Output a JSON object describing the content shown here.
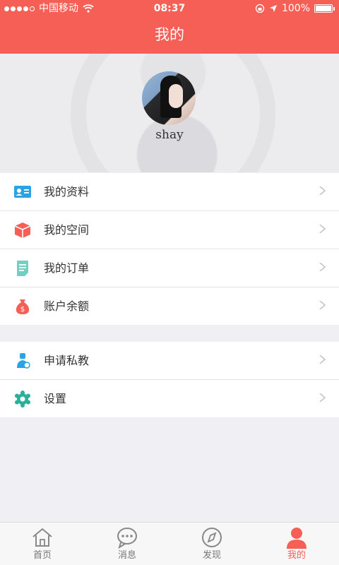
{
  "status_bar": {
    "carrier": "中国移动",
    "time": "08:37",
    "battery": "100%"
  },
  "nav": {
    "title": "我的"
  },
  "profile": {
    "username": "shay"
  },
  "menu_group_1": [
    {
      "label": "我的资料",
      "icon": "id-card-icon",
      "color": "#2aa3e6"
    },
    {
      "label": "我的空间",
      "icon": "cube-icon",
      "color": "#f65f55"
    },
    {
      "label": "我的订单",
      "icon": "document-icon",
      "color": "#6fd0c3"
    },
    {
      "label": "账户余额",
      "icon": "money-bag-icon",
      "color": "#f65f55"
    }
  ],
  "menu_group_2": [
    {
      "label": "申请私教",
      "icon": "coach-icon",
      "color": "#2aa3e6"
    },
    {
      "label": "设置",
      "icon": "gear-icon",
      "color": "#2ab09a"
    }
  ],
  "tabbar": [
    {
      "label": "首页",
      "icon": "home-icon"
    },
    {
      "label": "消息",
      "icon": "chat-icon"
    },
    {
      "label": "发现",
      "icon": "compass-icon"
    },
    {
      "label": "我的",
      "icon": "user-icon",
      "active": true
    }
  ],
  "colors": {
    "accent": "#f65f55",
    "background": "#efeff4"
  }
}
